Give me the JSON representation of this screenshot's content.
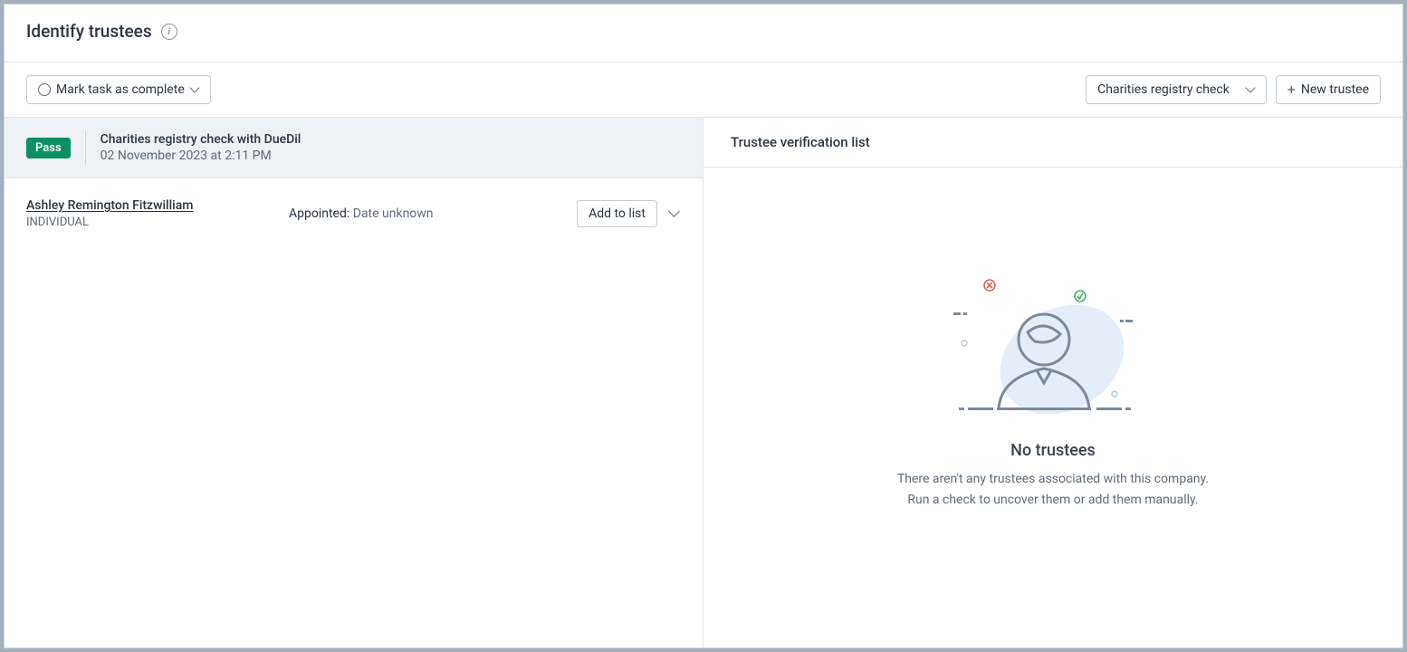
{
  "header": {
    "title": "Identify trustees"
  },
  "toolbar": {
    "mark_complete": "Mark task as complete",
    "check_dropdown": "Charities registry check",
    "new_trustee": "New trustee"
  },
  "check": {
    "status": "Pass",
    "title": "Charities registry check with DueDil",
    "timestamp": "02 November 2023 at 2:11 PM"
  },
  "trustees": [
    {
      "name": "Ashley Remington Fitzwilliam",
      "type": "INDIVIDUAL",
      "appointed_label": "Appointed:",
      "appointed_value": "Date unknown",
      "action": "Add to list"
    }
  ],
  "right": {
    "title": "Trustee verification list",
    "empty": {
      "title": "No trustees",
      "line1": "There aren't any trustees associated with this company.",
      "line2": "Run a check to uncover them or add them manually."
    }
  }
}
